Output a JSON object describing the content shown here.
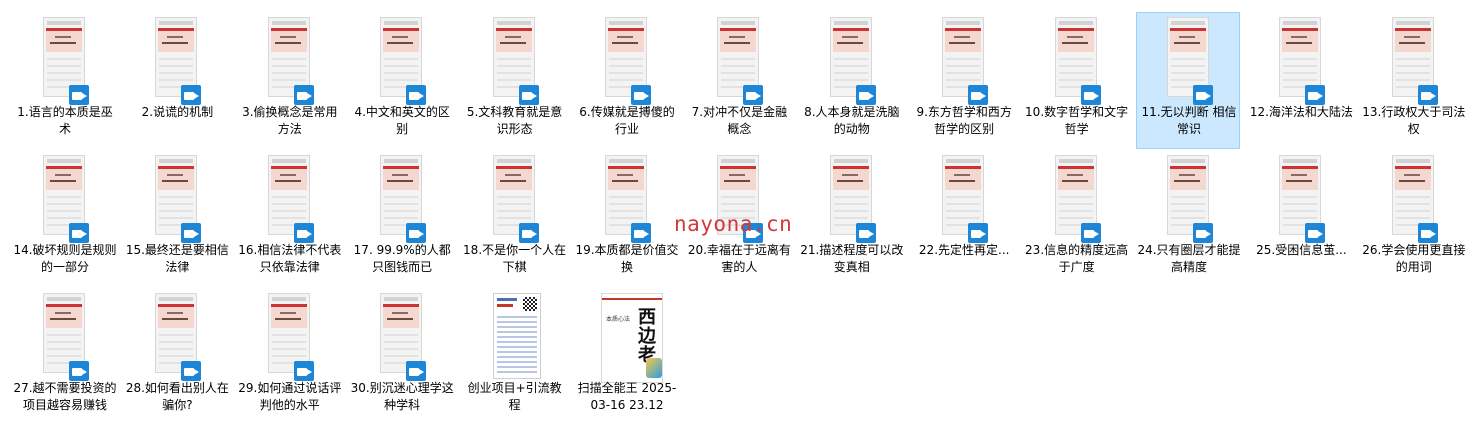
{
  "watermark": "nayona.cn",
  "rows": [
    [
      {
        "label": "1.语言的本质是巫术",
        "kind": "video"
      },
      {
        "label": "2.说谎的机制",
        "kind": "video"
      },
      {
        "label": "3.偷换概念是常用方法",
        "kind": "video"
      },
      {
        "label": "4.中文和英文的区别",
        "kind": "video"
      },
      {
        "label": "5.文科教育就是意识形态",
        "kind": "video"
      },
      {
        "label": "6.传媒就是搏傻的行业",
        "kind": "video"
      },
      {
        "label": "7.对冲不仅是金融概念",
        "kind": "video"
      },
      {
        "label": "8.人本身就是洗脑的动物",
        "kind": "video"
      },
      {
        "label": "9.东方哲学和西方哲学的区别",
        "kind": "video"
      },
      {
        "label": "10.数字哲学和文字哲学",
        "kind": "video"
      },
      {
        "label": "11.无以判断 相信常识",
        "kind": "video",
        "selected": true
      },
      {
        "label": "12.海洋法和大陆法",
        "kind": "video"
      },
      {
        "label": "13.行政权大于司法权",
        "kind": "video"
      }
    ],
    [
      {
        "label": "14.破坏规则是规则的一部分",
        "kind": "video"
      },
      {
        "label": "15.最终还是要相信法律",
        "kind": "video"
      },
      {
        "label": "16.相信法律不代表只依靠法律",
        "kind": "video"
      },
      {
        "label": "17. 99.9%的人都只图钱而已",
        "kind": "video"
      },
      {
        "label": "18.不是你一个人在下棋",
        "kind": "video"
      },
      {
        "label": "19.本质都是价值交换",
        "kind": "video"
      },
      {
        "label": "20.幸福在于远离有害的人",
        "kind": "video"
      },
      {
        "label": "21.描述程度可以改变真相",
        "kind": "video"
      },
      {
        "label": "22.先定性再定...",
        "kind": "video"
      },
      {
        "label": "23.信息的精度远高于广度",
        "kind": "video"
      },
      {
        "label": "24.只有圈层才能提高精度",
        "kind": "video"
      },
      {
        "label": "25.受困信息茧...",
        "kind": "video"
      },
      {
        "label": "26.学会使用更直接的用词",
        "kind": "video"
      }
    ],
    [
      {
        "label": "27.越不需要投资的项目越容易赚钱",
        "kind": "video"
      },
      {
        "label": "28.如何看出别人在骗你?",
        "kind": "video"
      },
      {
        "label": "29.如何通过说话评判他的水平",
        "kind": "video"
      },
      {
        "label": "30.别沉迷心理学这种学科",
        "kind": "video"
      },
      {
        "label": "创业项目+引流教程",
        "kind": "doc"
      },
      {
        "label": "扫描全能王 2025-03-16 23.12",
        "kind": "poster",
        "poster_caption": "本质心法",
        "poster_title": "西边老"
      }
    ]
  ]
}
